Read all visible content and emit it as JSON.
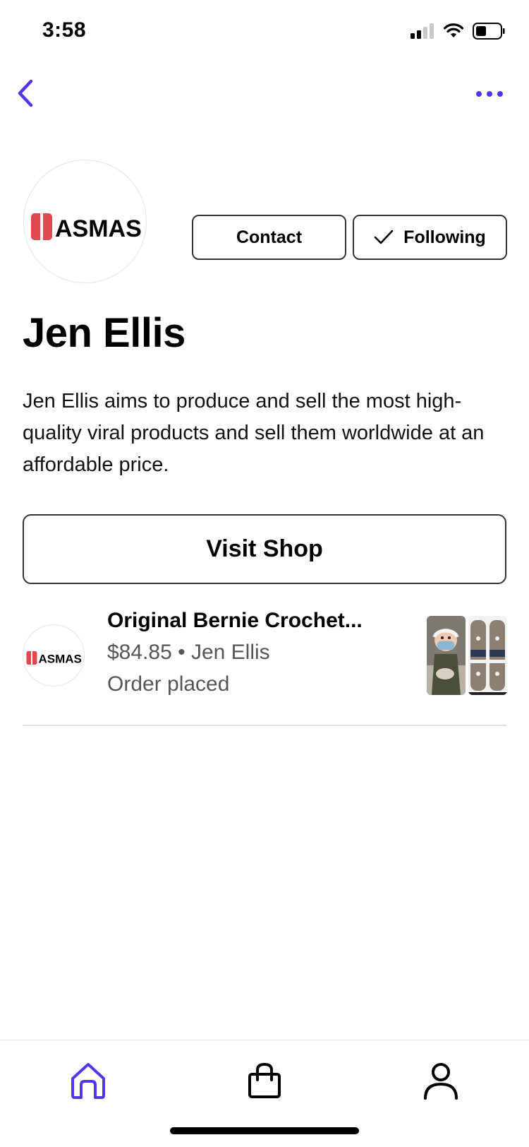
{
  "status_bar": {
    "time": "3:58"
  },
  "nav": {
    "back_icon": "chevron-left-icon",
    "more_icon": "ellipsis-icon"
  },
  "profile": {
    "logo_text": "ASMAS",
    "contact_label": "Contact",
    "following_label": "Following",
    "name": "Jen Ellis",
    "description": "Jen Ellis aims to produce and sell the most high-quality viral products and sell them worldwide at an affordable price.",
    "visit_shop_label": "Visit Shop"
  },
  "order": {
    "logo_text": "ASMAS",
    "title": "Original Bernie Crochet...",
    "price": "$84.85",
    "separator": "•",
    "seller": "Jen Ellis",
    "status": "Order placed"
  },
  "tab_bar": {
    "items": [
      {
        "name": "home",
        "icon": "home-icon",
        "active": true
      },
      {
        "name": "shop",
        "icon": "shopping-bag-icon",
        "active": false
      },
      {
        "name": "profile",
        "icon": "person-icon",
        "active": false
      }
    ]
  },
  "colors": {
    "accent": "#5433EB",
    "logo_red": "#E0474F",
    "text_secondary": "#555555",
    "border": "#333333"
  }
}
